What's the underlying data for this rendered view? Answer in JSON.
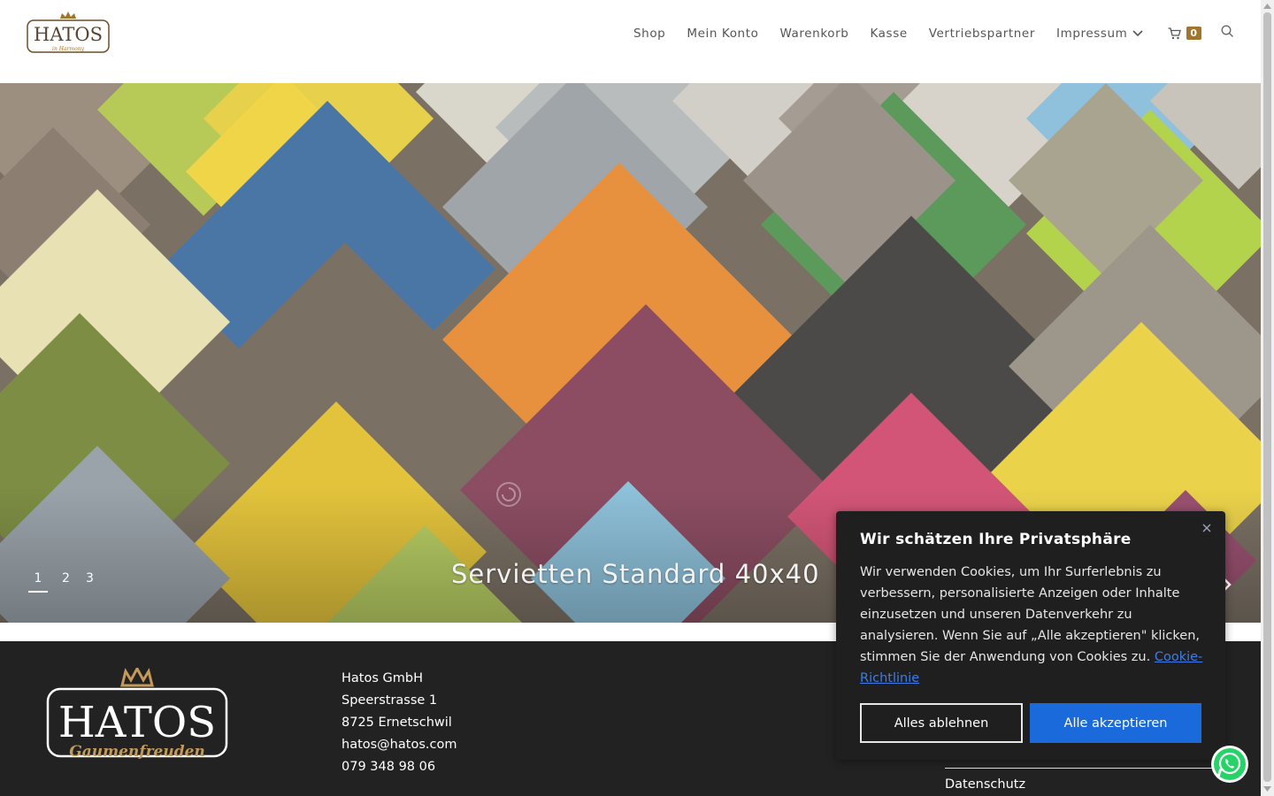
{
  "header": {
    "logo_text": "HATOS",
    "logo_sub": "in Harmony",
    "nav": [
      "Shop",
      "Mein Konto",
      "Warenkorb",
      "Kasse",
      "Vertriebspartner",
      "Impressum"
    ],
    "cart_count": "0",
    "icons": {
      "cart": "cart-icon",
      "search": "search-icon",
      "dropdown": "chevron-down-icon"
    }
  },
  "hero": {
    "title": "Servietten Standard 40x40",
    "pages": [
      "1",
      "2",
      "3"
    ],
    "active_page": "1"
  },
  "footer": {
    "logo_text": "HATOS",
    "logo_sub": "Gaumenfreuden",
    "address": [
      "Hatos GmbH",
      "Speerstrasse 1",
      "8725 Ernetschwil",
      "hatos@hatos.com",
      "079 348 98 06"
    ],
    "link": "Datenschutz"
  },
  "cookie": {
    "title": "Wir schätzen Ihre Privatsphäre",
    "body": "Wir verwenden Cookies, um Ihr Surferlebnis zu verbessern, personalisierte Anzeigen oder Inhalte einzusetzen und unseren Datenverkehr zu analysieren. Wenn Sie auf „Alle akzeptieren\" klicken, stimmen Sie der Anwendung von Cookies zu.",
    "link": "Cookie-Richtlinie",
    "decline": "Alles ablehnen",
    "accept": "Alle akzeptieren"
  },
  "colors": {
    "brand": "#a0752c",
    "accept": "#1b6adb",
    "footer_bg": "#222222"
  }
}
